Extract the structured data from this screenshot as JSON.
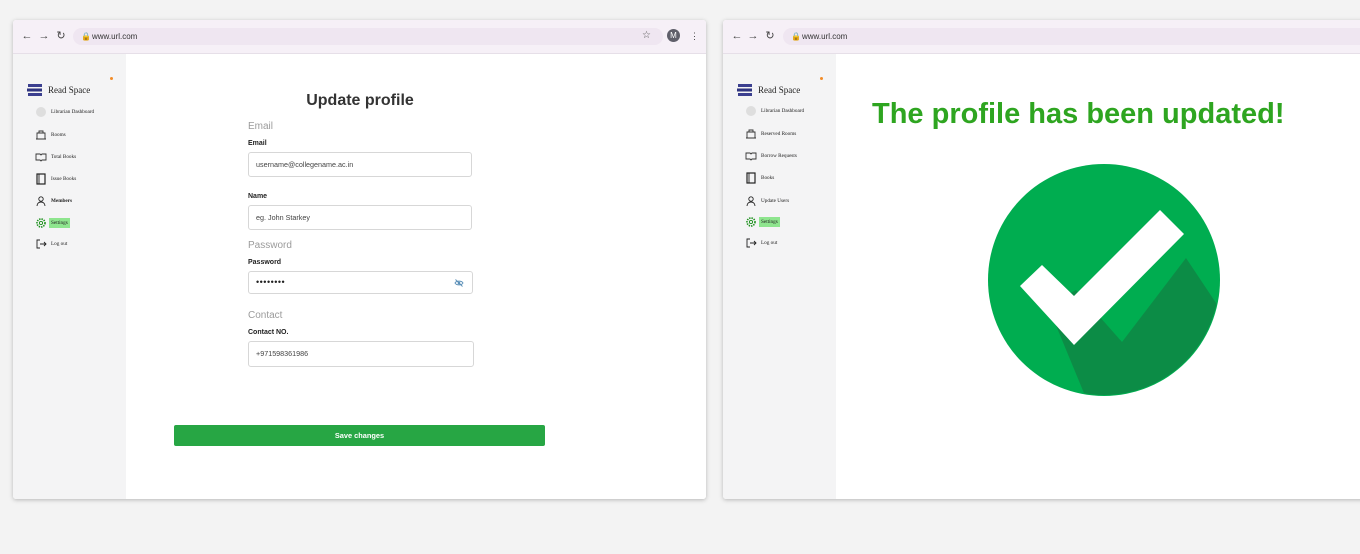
{
  "left_window": {
    "url": "www.url.com",
    "avatar_letter": "M",
    "brand": "Read Space",
    "nav": [
      {
        "label": "Librarian Dashboard",
        "icon": "dashboard-icon"
      },
      {
        "label": "Rooms",
        "icon": "rooms-icon"
      },
      {
        "label": "Total Books",
        "icon": "book-open-icon"
      },
      {
        "label": "Issue Books",
        "icon": "book-icon"
      },
      {
        "label": "Members",
        "icon": "user-icon"
      },
      {
        "label": "Settings",
        "icon": "gear-icon",
        "active": true
      },
      {
        "label": "Log out",
        "icon": "logout-icon"
      }
    ],
    "form": {
      "title": "Update  profile",
      "email_section": "Email",
      "email_label": "Email",
      "email_value": "username@collegename.ac.in",
      "name_label": "Name",
      "name_placeholder": "eg. John Starkey",
      "password_section": "Password",
      "password_label": "Password",
      "password_value": "••••••••",
      "contact_section": "Contact",
      "contact_label": "Contact NO.",
      "contact_value": "+971598361986",
      "save_label": "Save changes"
    }
  },
  "right_window": {
    "url": "www.url.com",
    "brand": "Read Space",
    "nav": [
      {
        "label": "Librarian Dashboard",
        "icon": "dashboard-icon"
      },
      {
        "label": "Reserved Rooms",
        "icon": "rooms-icon"
      },
      {
        "label": "Borrow Requests",
        "icon": "book-open-icon"
      },
      {
        "label": "Books",
        "icon": "book-icon"
      },
      {
        "label": "Update Users",
        "icon": "user-icon"
      },
      {
        "label": "Settings",
        "icon": "gear-icon",
        "active": true
      },
      {
        "label": "Log out",
        "icon": "logout-icon"
      }
    ],
    "success_message": "The profile has been updated!"
  },
  "colors": {
    "primary_green": "#27a644",
    "success_text": "#2ea520",
    "check_circle": "#00ad50",
    "active_nav": "#8ee58e",
    "brand_dot": "#f28c28"
  }
}
